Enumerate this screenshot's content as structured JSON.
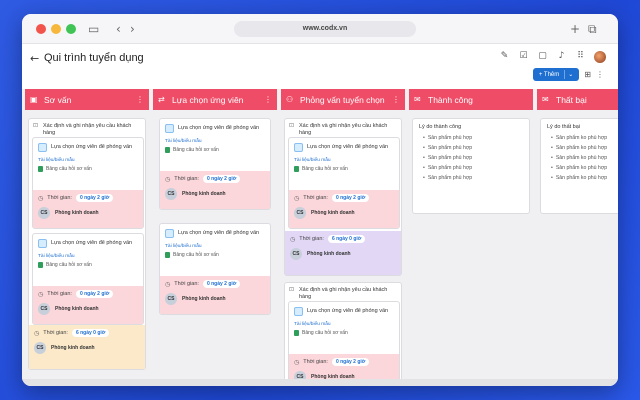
{
  "browser": {
    "url": "www.codx.vn"
  },
  "header": {
    "back": "←",
    "title": "Qui trình tuyển dụng"
  },
  "toolbar": {
    "add_label": "+ Thêm",
    "caret": "⌄"
  },
  "columns": [
    {
      "name": "Sơ vấn",
      "icon": "▣",
      "color": "#ef4d67"
    },
    {
      "name": "Lựa chọn ứng viên",
      "icon": "⇄",
      "color": "#ef4d67"
    },
    {
      "name": "Phỏng vấn tuyển chọn",
      "icon": "⚇",
      "color": "#ef4d67"
    },
    {
      "name": "Thành công",
      "icon": "✉",
      "color": "#ef4d67"
    },
    {
      "name": "Thất bại",
      "icon": "✉",
      "color": "#ef4d67"
    }
  ],
  "group_title": "Xác định và ghi nhận yêu cầu khách hàng",
  "card": {
    "title": "Lựa chọn ứng viên để phỏng vấn",
    "link": "Tài liệu/biểu mẫu",
    "doc": "Bảng câu hỏi sơ vấn",
    "time_label": "Thời gian:",
    "owner_initials": "CS",
    "owner_name": "Phòng kinh doanh"
  },
  "times": {
    "short": "0 ngày 2 giờ",
    "long": "6 ngày 0 giờ"
  },
  "outcome": {
    "success_title": "Lý do thành công",
    "fail_title": "Lý do thất bại",
    "success_item": "Sản phẩm phù hợp",
    "fail_item": "Sản phẩm ko phù hợp",
    "count": 5
  }
}
